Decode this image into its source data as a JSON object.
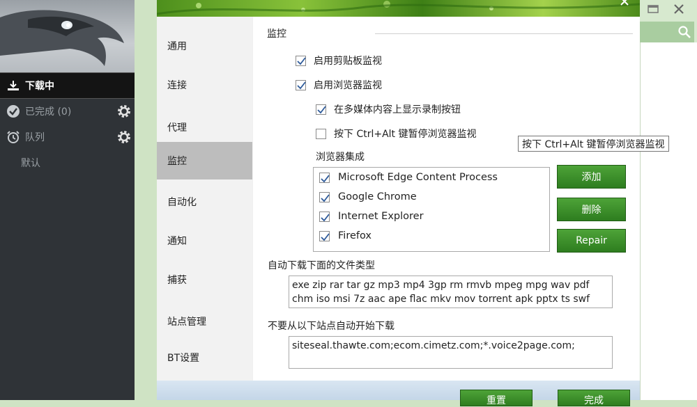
{
  "sidebar": {
    "items": [
      {
        "label": "下载中"
      },
      {
        "label": "已完成 (0)"
      },
      {
        "label": "队列"
      },
      {
        "label": "默认"
      }
    ]
  },
  "settings": {
    "categories": [
      "通用",
      "连接",
      "代理",
      "监控",
      "自动化",
      "通知",
      "捕获",
      "站点管理",
      "BT设置"
    ],
    "selected_category": "监控",
    "section_title": "监控",
    "options": [
      {
        "label": "启用剪贴板监视",
        "checked": true
      },
      {
        "label": "启用浏览器监视",
        "checked": true
      },
      {
        "label": "在多媒体内容上显示录制按钮",
        "checked": true
      },
      {
        "label": "按下 Ctrl+Alt 键暂停浏览器监视",
        "checked": false
      }
    ],
    "browser_integration_label": "浏览器集成",
    "browsers": [
      {
        "label": "Microsoft Edge Content Process",
        "checked": true
      },
      {
        "label": "Google Chrome",
        "checked": true
      },
      {
        "label": "Internet Explorer",
        "checked": true
      },
      {
        "label": "Firefox",
        "checked": true
      }
    ],
    "buttons": {
      "add": "添加",
      "delete": "删除",
      "repair": "Repair"
    },
    "auto_download_label": "自动下载下面的文件类型",
    "auto_download_types_line1": "exe zip rar tar gz mp3 mp4 3gp rm rmvb mpeg mpg wav pdf",
    "auto_download_types_line2": "chm iso msi 7z aac ape flac mkv mov torrent apk pptx ts swf",
    "no_auto_sites_label": "不要从以下站点自动开始下载",
    "no_auto_sites": "siteseal.thawte.com;ecom.cimetz.com;*.voice2page.com;",
    "footer": {
      "reset": "重置",
      "done": "完成"
    }
  },
  "tooltip": "按下 Ctrl+Alt 键暂停浏览器监视",
  "colors": {
    "accent_green": "#2e7d1f",
    "sidebar_dark": "#2f3337",
    "selected_category": "#bdbdbd"
  }
}
